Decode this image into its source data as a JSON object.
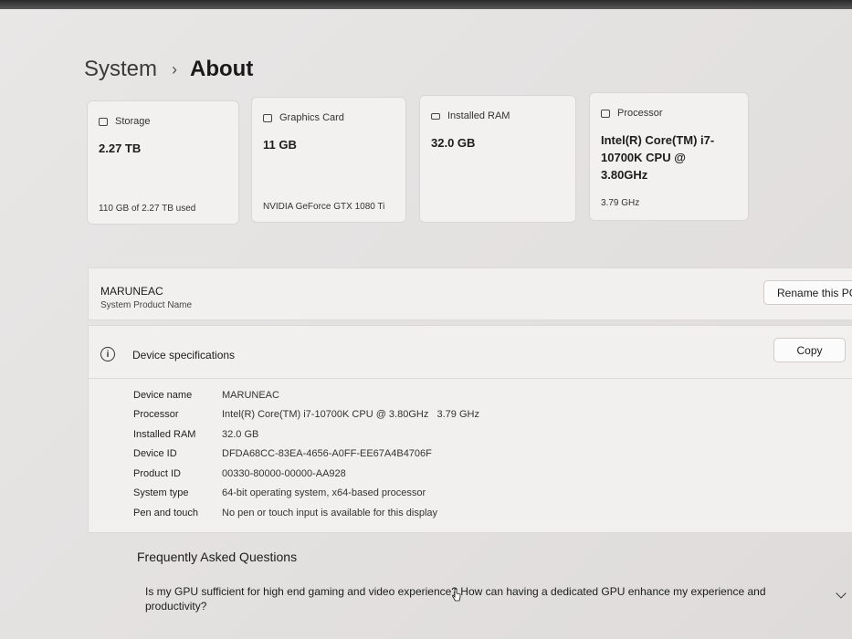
{
  "breadcrumb": {
    "root": "System",
    "separator": "›",
    "current": "About"
  },
  "cards": {
    "storage": {
      "label": "Storage",
      "value": "2.27 TB",
      "sub": "110 GB of 2.27 TB used"
    },
    "graphics": {
      "label": "Graphics Card",
      "value": "11 GB",
      "sub": "NVIDIA GeForce GTX 1080 Ti"
    },
    "ram": {
      "label": "Installed RAM",
      "value": "32.0 GB"
    },
    "processor": {
      "label": "Processor",
      "value": "Intel(R) Core(TM) i7-10700K CPU @ 3.80GHz",
      "sub": "3.79 GHz"
    }
  },
  "device": {
    "name": "MARUNEAC",
    "sub": "System Product Name",
    "rename_label": "Rename this PC"
  },
  "specs": {
    "title": "Device specifications",
    "copy_label": "Copy",
    "rows": [
      {
        "k": "Device name",
        "v": "MARUNEAC"
      },
      {
        "k": "Processor",
        "v": "Intel(R) Core(TM) i7-10700K CPU @ 3.80GHz   3.79 GHz"
      },
      {
        "k": "Installed RAM",
        "v": "32.0 GB"
      },
      {
        "k": "Device ID",
        "v": "DFDA68CC-83EA-4656-A0FF-EE67A4B4706F"
      },
      {
        "k": "Product ID",
        "v": "00330-80000-00000-AA928"
      },
      {
        "k": "System type",
        "v": "64-bit operating system, x64-based processor"
      },
      {
        "k": "Pen and touch",
        "v": "No pen or touch input is available for this display"
      }
    ]
  },
  "faq": {
    "title": "Frequently Asked Questions",
    "question": "Is my GPU sufficient for high end gaming and video experience? How can having a dedicated GPU enhance my experience and productivity?"
  }
}
